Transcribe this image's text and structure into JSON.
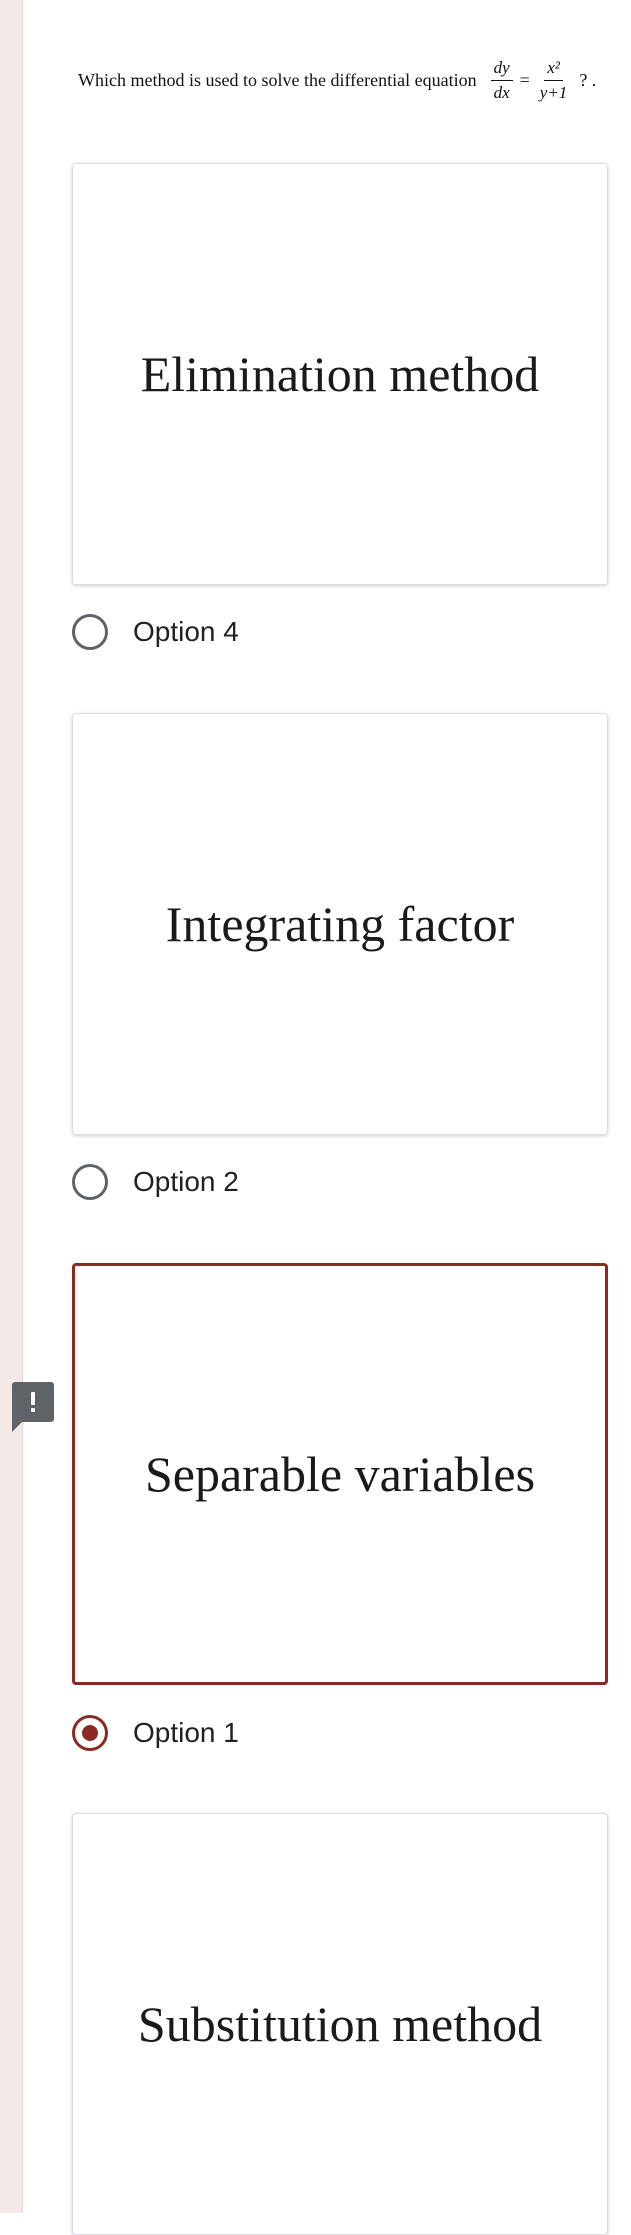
{
  "question": {
    "text": "Which method is used to solve the differential equation",
    "lhs_num": "dy",
    "lhs_den": "dx",
    "equals": "=",
    "rhs_num": "x²",
    "rhs_den": "y+1",
    "trailing": "? ."
  },
  "choices": [
    {
      "image_text": "Elimination method",
      "option_label": "Option 4",
      "selected": false
    },
    {
      "image_text": "Integrating factor",
      "option_label": "Option 2",
      "selected": false
    },
    {
      "image_text": "Separable variables",
      "option_label": "Option 1",
      "selected": true
    },
    {
      "image_text": "Substitution method",
      "option_label": "",
      "selected": false
    }
  ],
  "alert": {
    "icon": "alert-icon",
    "symbol": "!"
  },
  "colors": {
    "accent": "#8a2a22",
    "radio_unchecked": "#5f6368",
    "rail": "#f3e9e8"
  }
}
